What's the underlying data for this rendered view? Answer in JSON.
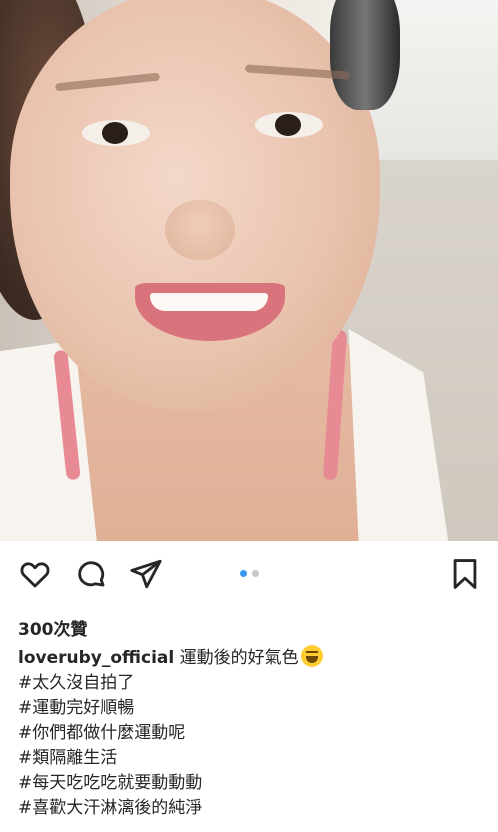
{
  "post": {
    "likes_text": "300次贊",
    "username": "loveruby_official",
    "caption_text": "運動後的好氣色",
    "emoji_icon": "laughing-face-icon",
    "hashtags": [
      "#太久沒自拍了",
      "#運動完好順暢",
      "#你們都做什麼運動呢",
      "#類隔離生活",
      "#每天吃吃吃就要動動動",
      "#喜歡大汗淋漓後的純淨"
    ],
    "carousel": {
      "count": 2,
      "active_index": 0
    }
  },
  "actions": {
    "icons": [
      "heart-icon",
      "comment-icon",
      "share-icon",
      "bookmark-icon"
    ]
  },
  "colors": {
    "carousel_active": "#3897f0",
    "carousel_inactive": "#c7c7c7"
  }
}
